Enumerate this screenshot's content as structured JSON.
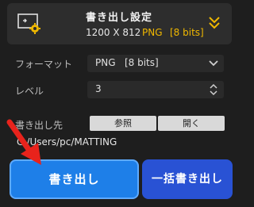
{
  "header": {
    "title": "書き出し設定",
    "size": "1200 X 812",
    "format": "PNG",
    "bits": "[8 bits]",
    "accent_color": "#f0b800",
    "icon": "export-screen-gear-icon",
    "collapse_icon": "double-chevron-down-icon"
  },
  "format_row": {
    "label": "フォーマット",
    "value": "PNG   [8 bits]",
    "icon": "chevron-down-icon"
  },
  "level_row": {
    "label": "レベル",
    "value": "3",
    "icon": "spinner-arrows-icon"
  },
  "destination": {
    "label": "書き出し先",
    "browse_label": "参照",
    "open_label": "開く",
    "path": "C:/Users/pc/MATTING"
  },
  "actions": {
    "export_label": "書き出し",
    "batch_export_label": "一括書き出し",
    "export_color": "#1e7fe8",
    "batch_color": "#2952d4"
  },
  "annotation": {
    "icon": "red-pointer-arrow-icon",
    "color": "#e8231c"
  }
}
